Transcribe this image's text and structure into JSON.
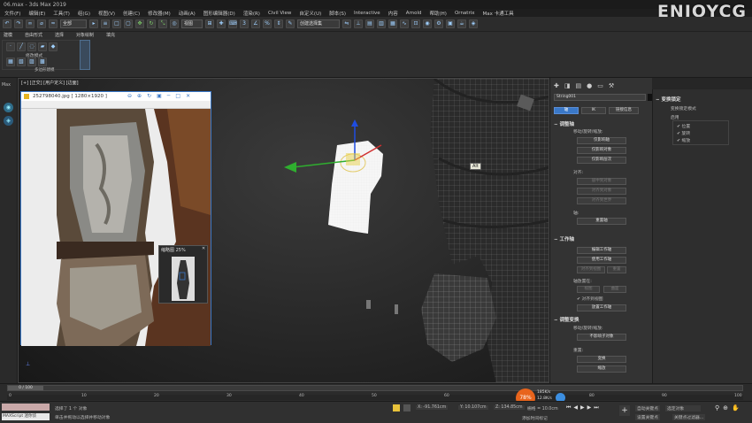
{
  "window": {
    "title": "06.max - 3ds Max 2019"
  },
  "menu": [
    "文件(F)",
    "编辑(E)",
    "工具(T)",
    "组(G)",
    "视图(V)",
    "创建(C)",
    "修改器(M)",
    "动画(A)",
    "图形编辑器(D)",
    "渲染(R)",
    "Civil View",
    "自定义(U)",
    "脚本(S)",
    "Interactive",
    "内容",
    "Arnold",
    "帮助(H)",
    "Ornatrix",
    "Max 卡通工具"
  ],
  "brand": "ENJOYCG",
  "toolbar": {
    "filter_dropdown": "全部",
    "view_dropdown": "视图",
    "selection_set": "创建选择集"
  },
  "ribbon": {
    "tabs": [
      "建模",
      "自由形式",
      "选择",
      "对象绘制",
      "填充"
    ],
    "group_label": "多边形建模",
    "mode_label": "修改模式"
  },
  "viewport": {
    "label": "[+] [正交] [用户定义] [边面]"
  },
  "image_window": {
    "title": "252798040.jpg [ 1280×1920 ]"
  },
  "small_window": {
    "title": "缩略图 25%"
  },
  "tooltip": "Alt",
  "command_panel": {
    "object_name": "String001",
    "tabs": [
      "轴",
      "IK",
      "链接信息"
    ],
    "adjust_pivot": {
      "title": "调整轴",
      "move_rotate_scale": "移动/旋转/缩放:",
      "buttons": [
        "仅影响轴",
        "仅影响对象",
        "仅影响层次"
      ],
      "align_label": "对齐:",
      "align_buttons": [
        "居中到对象",
        "对齐到对象",
        "对齐到世界"
      ],
      "pivot_label": "轴:",
      "reset_pivot": "重置轴"
    },
    "working_pivot": {
      "title": "工作轴",
      "buttons": [
        "编辑工作轴",
        "使用工作轴",
        "对齐到视图",
        "重置"
      ],
      "place_label": "轴放置在:",
      "place_buttons": [
        "视图",
        "曲面"
      ],
      "align_view": "对齐到视图",
      "place_pivot": "放置工作轴"
    },
    "adjust_transform": {
      "title": "调整变换",
      "move_rotate_scale": "移动/旋转/缩放:",
      "dont_affect_children": "不影响子对象",
      "reset_label": "重置:",
      "reset_buttons": [
        "变换",
        "缩放"
      ]
    }
  },
  "ext_panel": {
    "title": "变换锁定",
    "subtitle": "变换锁定模式",
    "lock_label": "启用",
    "items": [
      "位置",
      "旋转",
      "缩放"
    ]
  },
  "timeline": {
    "frame_label": "0 / 100",
    "ticks": [
      "0",
      "10",
      "20",
      "30",
      "40",
      "50",
      "60",
      "70",
      "80",
      "90",
      "100"
    ]
  },
  "status": {
    "script_label": "MAXScript 迷你侦",
    "selected": "选择了 1 个 对象",
    "hint": "单击并拖动以选择并移动对象",
    "x": "X: -91.761cm",
    "y": "Y: 10.107cm",
    "z": "Z: 134.85cm",
    "grid": "栅格 = 10.0cm",
    "add_time_tag": "添加时间标记",
    "autokey": "自动关键点",
    "setkey": "设置关键点",
    "selected_dropdown": "选定对象",
    "key_filters": "关键点过滤器...",
    "net_up": "185K/s",
    "net_down": "12.8K/s",
    "orange_badge": "78%"
  },
  "colors": {
    "accent": "#3a78c8",
    "orange": "#e8641c",
    "viewport": "#2a2a2a"
  }
}
